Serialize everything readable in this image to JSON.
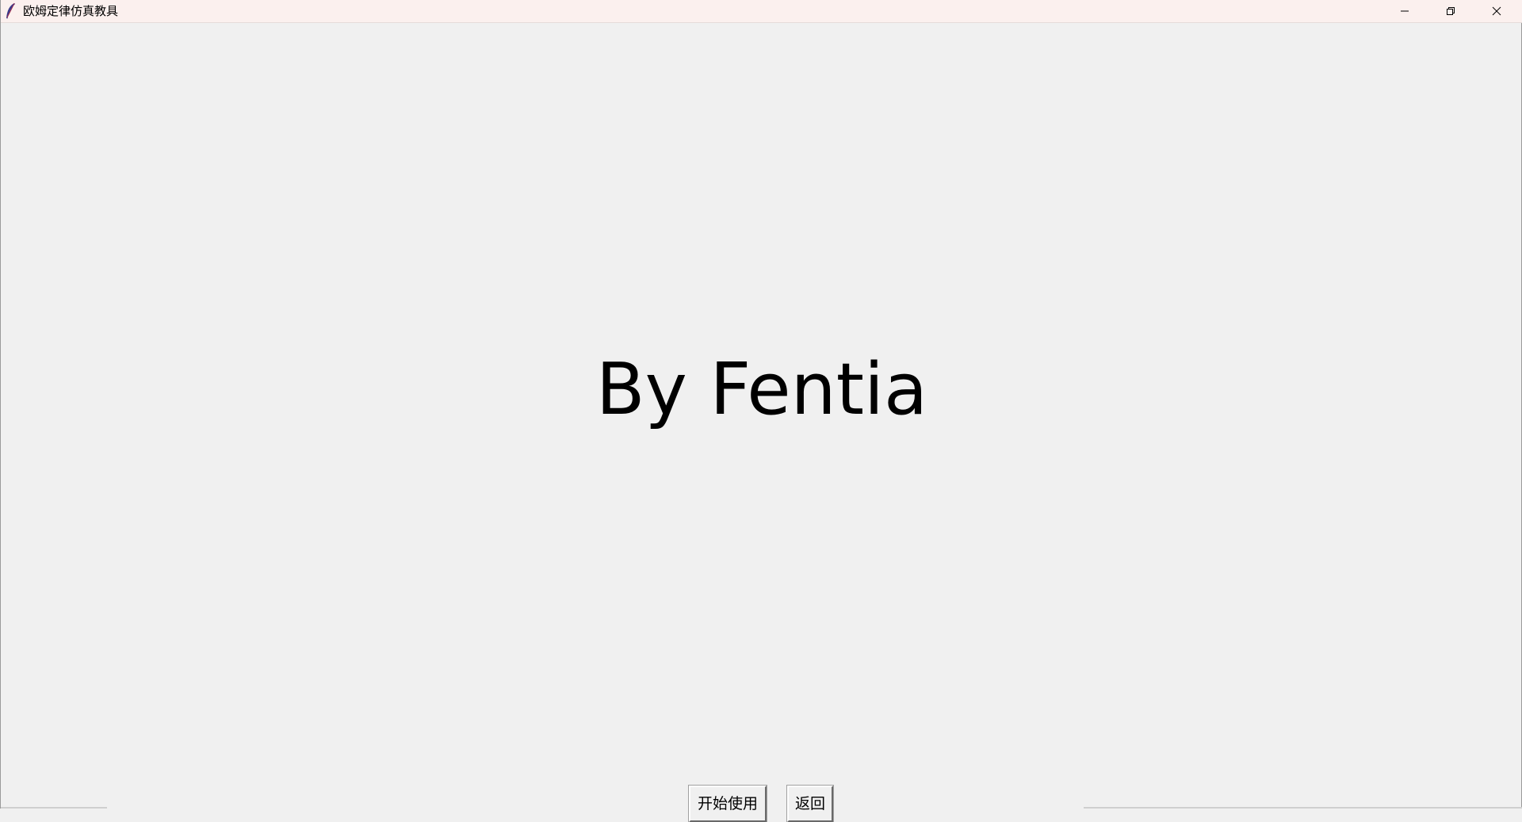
{
  "window": {
    "title": "欧姆定律仿真教具",
    "icons": {
      "app": "tk-feather-icon",
      "minimize": "minimize-icon",
      "maximize": "restore-icon",
      "close": "close-icon"
    }
  },
  "main": {
    "heading": "By Fentia"
  },
  "buttons": {
    "start_label": "开始使用",
    "back_label": "返回"
  },
  "colors": {
    "titlebar_bg": "#fbf0ee",
    "window_bg": "#f0f0f0",
    "text": "#000000"
  }
}
